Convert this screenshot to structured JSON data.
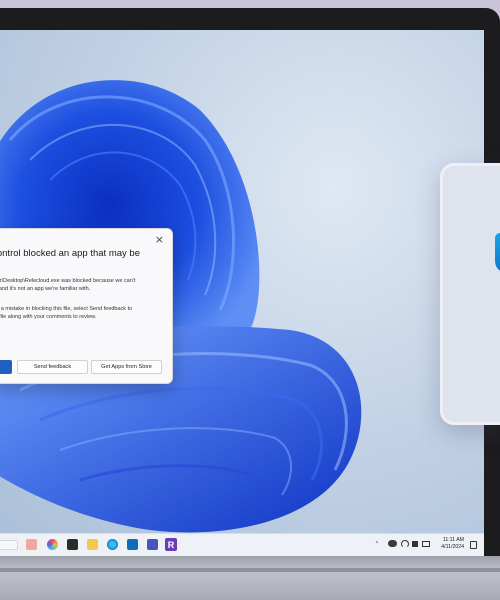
{
  "dialog": {
    "close_glyph": "×",
    "title": "Control blocked an app that may be",
    "message_line1": "User\\Desktop\\Relecloud.exe was blocked because we can't",
    "message_line2": "e it and it's not an app we're familiar with.",
    "message_line3": "ade a mistake in blocking this file, select Send feedback to",
    "message_line4": "the file along with your comments to review.",
    "send_feedback_label": "Send feedback",
    "get_apps_label": "Get Apps from Store"
  },
  "taskbar": {
    "clock_time": "11:11 AM",
    "clock_date": "4/11/2024",
    "tray_chevron": "˄",
    "app_letter": "R"
  },
  "colors": {
    "primary_button": "#1f5fbf",
    "wallpaper_bloom": "#1d4fe0"
  }
}
